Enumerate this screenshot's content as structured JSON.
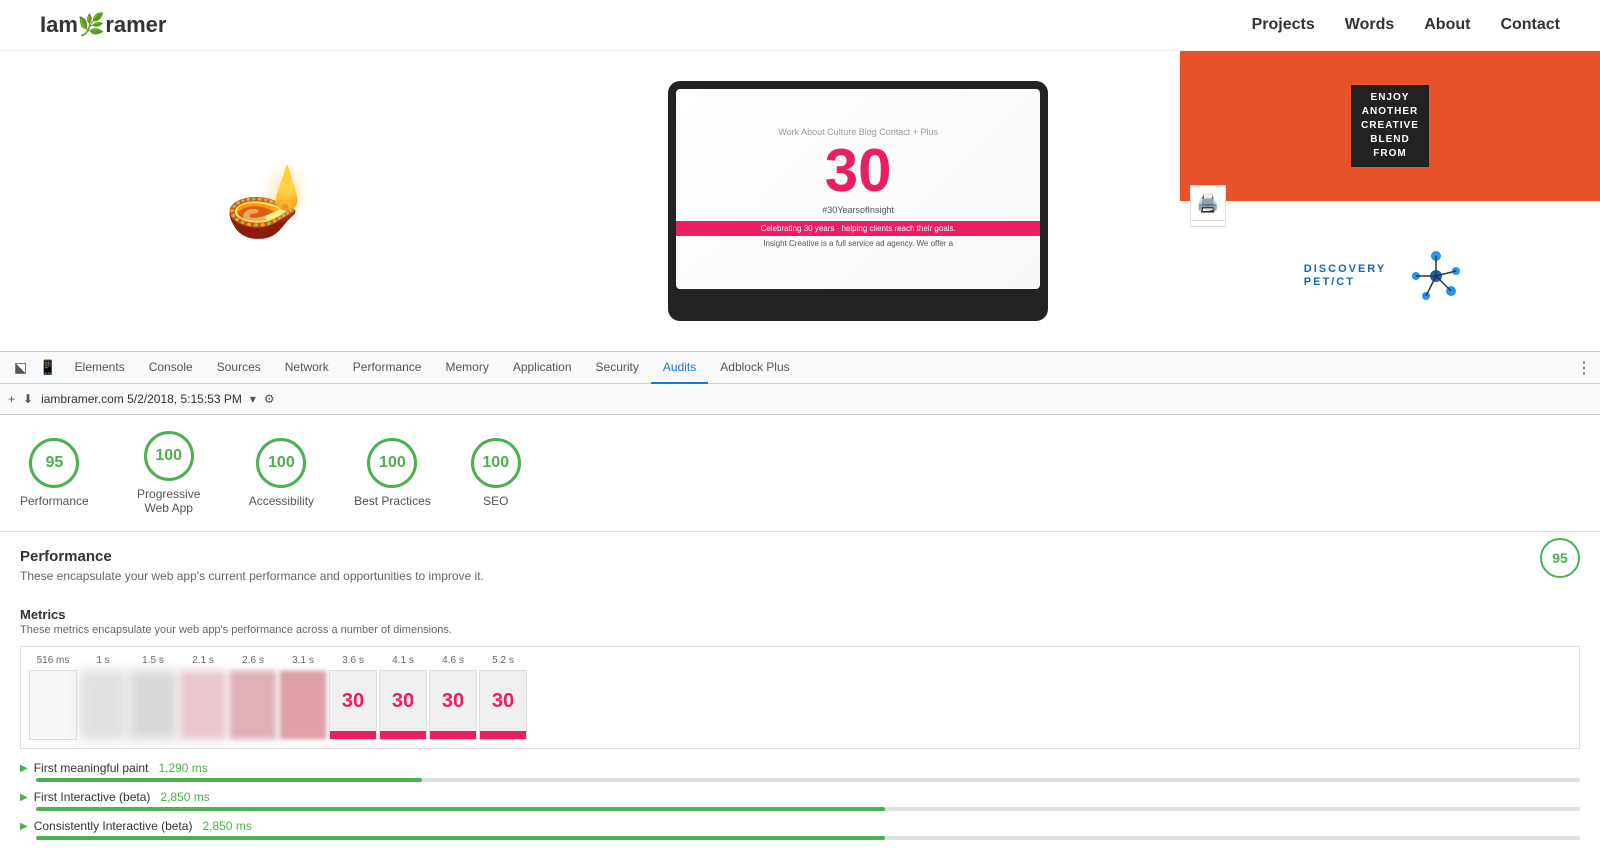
{
  "site": {
    "logo": "Iam",
    "logo_accent": "🌿",
    "logo_end": "ramer",
    "nav": [
      "Projects",
      "Words",
      "About",
      "Contact"
    ]
  },
  "devtools": {
    "tabs": [
      "Elements",
      "Console",
      "Sources",
      "Network",
      "Performance",
      "Memory",
      "Application",
      "Security",
      "Audits",
      "Adblock Plus"
    ],
    "active_tab": "Audits",
    "url": "iambramer.com 5/2/2018, 5:15:53 PM",
    "reload_icon": "▸",
    "add_label": "+",
    "download_label": "⬇"
  },
  "scores": [
    {
      "value": "95",
      "label": "Performance"
    },
    {
      "value": "100",
      "label": "Progressive Web App"
    },
    {
      "value": "100",
      "label": "Accessibility"
    },
    {
      "value": "100",
      "label": "Best Practices"
    },
    {
      "value": "100",
      "label": "SEO"
    }
  ],
  "performance": {
    "title": "Performance",
    "description": "These encapsulate your web app's current performance and opportunities to improve it.",
    "score": "95"
  },
  "metrics": {
    "title": "Metrics",
    "description": "These metrics encapsulate your web app's performance across a number of dimensions.",
    "timeline_labels": [
      "516 ms",
      "1 s",
      "1.5 s",
      "2.1 s",
      "2.6 s",
      "3.1 s",
      "3.6 s",
      "4.1 s",
      "4.6 s",
      "5.2 s"
    ],
    "items": [
      {
        "name": "First meaningful paint",
        "value": "1,290 ms",
        "bar_width": "25%"
      },
      {
        "name": "First Interactive (beta)",
        "value": "2,850 ms",
        "bar_width": "55%"
      },
      {
        "name": "Consistently Interactive (beta)",
        "value": "2,850 ms",
        "bar_width": "55%"
      }
    ]
  },
  "screen": {
    "number": "30",
    "hashtag": "#30YearsofInsight",
    "banner": "Celebrating 30 years · helping clients reach their goals.",
    "tagline": "Insight Creative is a full service ad agency. We offer a"
  },
  "right_panel": {
    "top_text": "ENJOY\nANOTHER\nCREATIVE\nBLEND\nFROM",
    "discovery_text": "DISCOVERY\nPET/CT"
  }
}
